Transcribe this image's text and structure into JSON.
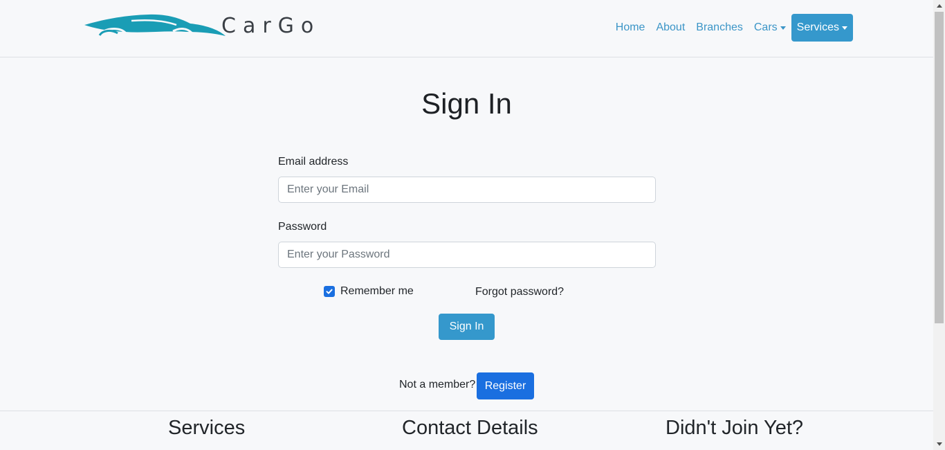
{
  "brand": {
    "name": "CarGo",
    "logo_icon": "car-silhouette-icon",
    "accent": "#1a9db5"
  },
  "nav": {
    "home": "Home",
    "about": "About",
    "branches": "Branches",
    "cars": "Cars",
    "services": "Services"
  },
  "form": {
    "title": "Sign In",
    "email_label": "Email address",
    "email_placeholder": "Enter your Email",
    "email_value": "",
    "password_label": "Password",
    "password_placeholder": "Enter your Password",
    "password_value": "",
    "remember_label": "Remember me",
    "remember_checked": true,
    "forgot_label": "Forgot password?",
    "submit_label": "Sign In",
    "not_member_text": "Not a member?",
    "register_label": "Register"
  },
  "footer": {
    "col1_title": "Services",
    "col2_title": "Contact Details",
    "col3_title": "Didn't Join Yet?"
  },
  "colors": {
    "primary_button": "#3598cc",
    "register_button": "#1a6fe0",
    "link": "#3b95c7"
  }
}
